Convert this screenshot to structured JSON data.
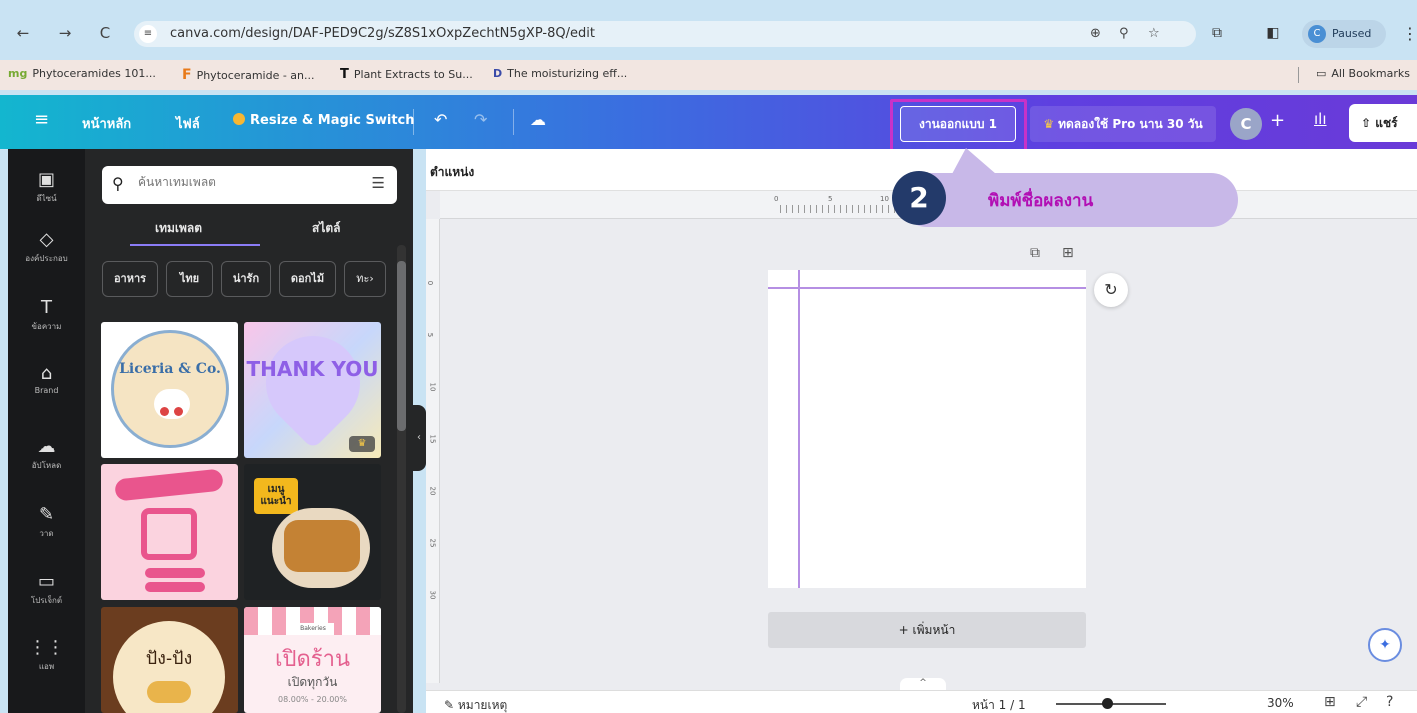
{
  "browser": {
    "url": "canva.com/design/DAF-PED9C2g/sZ8S1xOxpZechtN5gXP-8Q/edit",
    "profile_initial": "C",
    "profile_label": "Paused",
    "bookmarks": [
      {
        "icon": "mg",
        "label": "Phytoceramides 101..."
      },
      {
        "icon": "F",
        "label": "Phytoceramide - an..."
      },
      {
        "icon": "T",
        "label": "Plant Extracts to Su..."
      },
      {
        "icon": "D",
        "label": "The moisturizing eff..."
      }
    ],
    "all_bookmarks": "All Bookmarks"
  },
  "header": {
    "home": "หน้าหลัก",
    "file": "ไฟล์",
    "resize": "Resize & Magic Switch",
    "title_value": "งานออกแบบ 1",
    "pro_trial": "ทดลองใช้ Pro นาน 30 วัน",
    "avatar_initial": "C",
    "share": "แชร์"
  },
  "rail": [
    {
      "icon": "layout-icon",
      "glyph": "▣",
      "label": "ดีไซน์"
    },
    {
      "icon": "elements-icon",
      "glyph": "◇",
      "label": "องค์ประกอบ"
    },
    {
      "icon": "text-icon",
      "glyph": "T",
      "label": "ข้อความ"
    },
    {
      "icon": "brand-icon",
      "glyph": "⌂",
      "label": "Brand"
    },
    {
      "icon": "upload-icon",
      "glyph": "☁",
      "label": "อัปโหลด"
    },
    {
      "icon": "draw-icon",
      "glyph": "✎",
      "label": "วาด"
    },
    {
      "icon": "folder-icon",
      "glyph": "▭",
      "label": "โปรเจ็กต์"
    },
    {
      "icon": "apps-icon",
      "glyph": "⋮⋮",
      "label": "แอพ"
    }
  ],
  "panel": {
    "search_placeholder": "ค้นหาเทมเพลต",
    "tab_templates": "เทมเพลต",
    "tab_styles": "สไตล์",
    "chips": [
      "อาหาร",
      "ไทย",
      "น่ารัก",
      "ดอกไม้",
      "ทะ"
    ],
    "templates": {
      "liceria": "Liceria & Co.",
      "thank_you": "THANK YOU",
      "snack": "เมนู แนะนำ",
      "bang": "ปัง-ปัง",
      "open": "เปิดร้าน",
      "open_sub": "เปิดทุกวัน",
      "open_time": "08.00% - 20.00%",
      "open_sign": "Bakeries"
    }
  },
  "workspace": {
    "context_label": "ตำแหน่ง",
    "ruler_h": [
      "0",
      "5",
      "10"
    ],
    "ruler_v": [
      "0",
      "5",
      "10",
      "15",
      "20",
      "25",
      "30"
    ],
    "add_page": "+ เพิ่มหน้า"
  },
  "callout": {
    "number": "2",
    "text": "พิมพ์ชื่อผลงาน"
  },
  "footer": {
    "notes": "หมายเหตุ",
    "page_count": "หน้า 1 / 1",
    "zoom": "30%",
    "zoom_fraction": 0.3
  },
  "colors": {
    "callout_text": "#b20fb4",
    "highlight_border": "#c832c8",
    "callout_badge": "#233a6a",
    "callout_fill": "#c8b8e8",
    "guide": "#b58fe3"
  }
}
